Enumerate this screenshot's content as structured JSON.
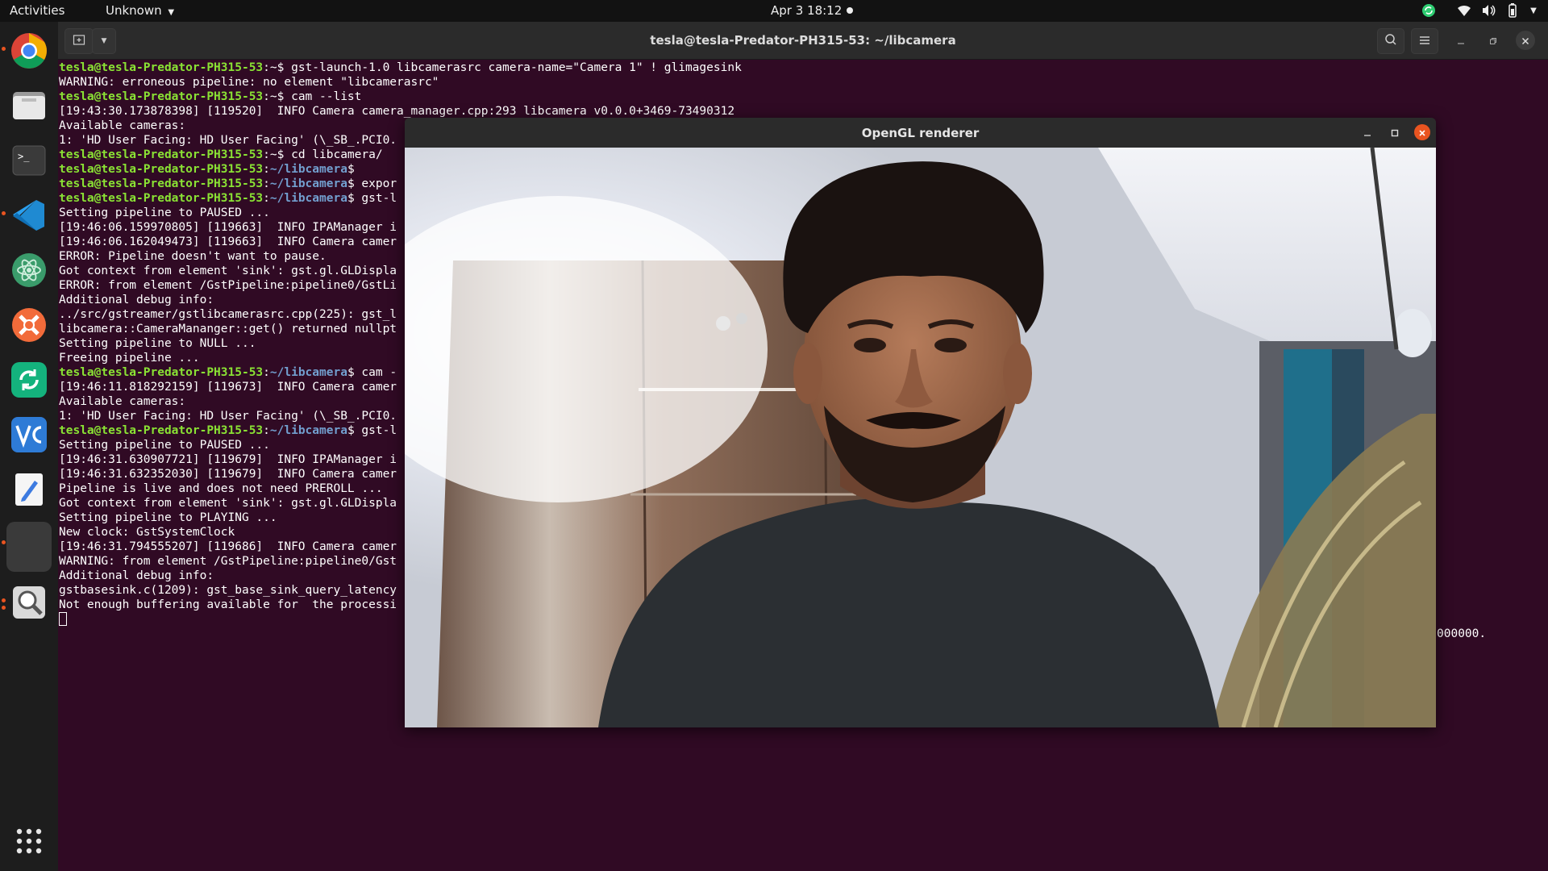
{
  "topbar": {
    "activities": "Activities",
    "app_menu": "Unknown",
    "clock": "Apr 3  18:12"
  },
  "dock": {
    "items": [
      "chrome-icon",
      "files-icon",
      "terminal-icon",
      "vscode-icon",
      "atom-icon",
      "postman-icon",
      "git-sync-icon",
      "vnc-viewer-icon",
      "text-editor-icon",
      "blank-app",
      "search-app-icon"
    ],
    "show_apps": "show-applications-icon"
  },
  "terminal": {
    "title": "tesla@tesla-Predator-PH315-53: ~/libcamera",
    "lines": [
      [
        [
          "u",
          "tesla@tesla-Predator-PH315-53"
        ],
        [
          "t",
          ":~$ gst-launch-1.0 libcamerasrc camera-name=\"Camera 1\" ! glimagesink"
        ]
      ],
      [
        [
          "t",
          "WARNING: erroneous pipeline: no element \"libcamerasrc\""
        ]
      ],
      [
        [
          "u",
          "tesla@tesla-Predator-PH315-53"
        ],
        [
          "t",
          ":~$ cam --list"
        ]
      ],
      [
        [
          "t",
          "[19:43:30.173878398] [119520]  INFO Camera camera_manager.cpp:293 libcamera v0.0.0+3469-73490312"
        ]
      ],
      [
        [
          "t",
          "Available cameras:"
        ]
      ],
      [
        [
          "t",
          "1: 'HD User Facing: HD User Facing' (\\_SB_.PCI0."
        ]
      ],
      [
        [
          "u",
          "tesla@tesla-Predator-PH315-53"
        ],
        [
          "t",
          ":~$ cd libcamera/"
        ]
      ],
      [
        [
          "u",
          "tesla@tesla-Predator-PH315-53"
        ],
        [
          "t",
          ":"
        ],
        [
          "p",
          "~/libcamera"
        ],
        [
          "t",
          "$"
        ]
      ],
      [
        [
          "u",
          "tesla@tesla-Predator-PH315-53"
        ],
        [
          "t",
          ":"
        ],
        [
          "p",
          "~/libcamera"
        ],
        [
          "t",
          "$ expor"
        ]
      ],
      [
        [
          "u",
          "tesla@tesla-Predator-PH315-53"
        ],
        [
          "t",
          ":"
        ],
        [
          "p",
          "~/libcamera"
        ],
        [
          "t",
          "$ gst-l"
        ]
      ],
      [
        [
          "t",
          "Setting pipeline to PAUSED ..."
        ]
      ],
      [
        [
          "t",
          "[19:46:06.159970805] [119663]  INFO IPAManager i"
        ]
      ],
      [
        [
          "t",
          "[19:46:06.162049473] [119663]  INFO Camera camer"
        ]
      ],
      [
        [
          "t",
          "ERROR: Pipeline doesn't want to pause."
        ]
      ],
      [
        [
          "t",
          "Got context from element 'sink': gst.gl.GLDispla"
        ]
      ],
      [
        [
          "t",
          "ERROR: from element /GstPipeline:pipeline0/GstLi"
        ]
      ],
      [
        [
          "t",
          "Additional debug info:"
        ]
      ],
      [
        [
          "t",
          "../src/gstreamer/gstlibcamerasrc.cpp(225): gst_l"
        ]
      ],
      [
        [
          "t",
          "libcamera::CameraMananger::get() returned nullpt"
        ]
      ],
      [
        [
          "t",
          "Setting pipeline to NULL ..."
        ]
      ],
      [
        [
          "t",
          "Freeing pipeline ..."
        ]
      ],
      [
        [
          "u",
          "tesla@tesla-Predator-PH315-53"
        ],
        [
          "t",
          ":"
        ],
        [
          "p",
          "~/libcamera"
        ],
        [
          "t",
          "$ cam -"
        ]
      ],
      [
        [
          "t",
          "[19:46:11.818292159] [119673]  INFO Camera camer"
        ]
      ],
      [
        [
          "t",
          "Available cameras:"
        ]
      ],
      [
        [
          "t",
          "1: 'HD User Facing: HD User Facing' (\\_SB_.PCI0."
        ]
      ],
      [
        [
          "u",
          "tesla@tesla-Predator-PH315-53"
        ],
        [
          "t",
          ":"
        ],
        [
          "p",
          "~/libcamera"
        ],
        [
          "t",
          "$ gst-l"
        ]
      ],
      [
        [
          "t",
          "Setting pipeline to PAUSED ..."
        ]
      ],
      [
        [
          "t",
          "[19:46:31.630907721] [119679]  INFO IPAManager i"
        ]
      ],
      [
        [
          "t",
          "[19:46:31.632352030] [119679]  INFO Camera camer"
        ]
      ],
      [
        [
          "t",
          "Pipeline is live and does not need PREROLL ..."
        ]
      ],
      [
        [
          "t",
          "Got context from element 'sink': gst.gl.GLDispla"
        ]
      ],
      [
        [
          "t",
          "Setting pipeline to PLAYING ..."
        ]
      ],
      [
        [
          "t",
          "New clock: GstSystemClock"
        ]
      ],
      [
        [
          "t",
          "[19:46:31.794555207] [119686]  INFO Camera camer"
        ]
      ],
      [
        [
          "t",
          "WARNING: from element /GstPipeline:pipeline0/Gst"
        ]
      ],
      [
        [
          "t",
          "Additional debug info:"
        ]
      ],
      [
        [
          "t",
          "gstbasesink.c(1209): gst_base_sink_query_latency"
        ]
      ],
      [
        [
          "t",
          "Not enough buffering available for  the processi"
        ]
      ]
    ],
    "overflow_text": "000000."
  },
  "gl_window": {
    "title": "OpenGL renderer"
  }
}
